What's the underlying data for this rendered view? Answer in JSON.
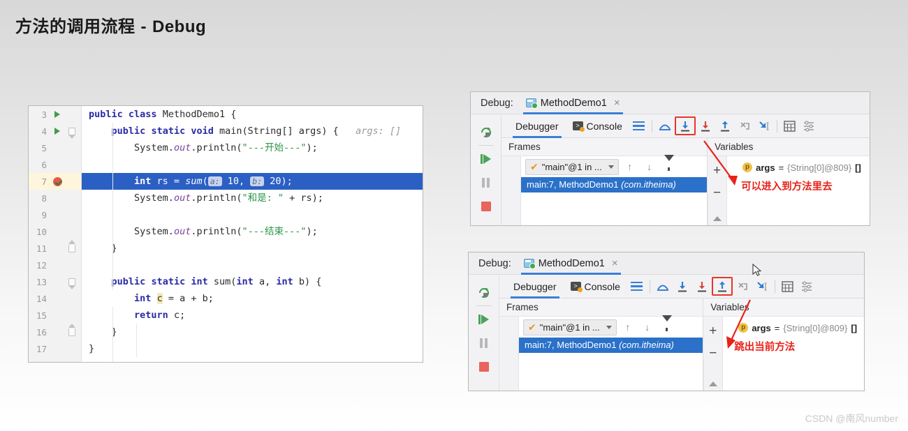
{
  "slide": {
    "title_cn": "方法的调用流程",
    "title_dash": "-",
    "title_en": "Debug"
  },
  "watermark": "CSDN @南风number",
  "editor": {
    "lines": [
      {
        "num": "3",
        "gutter_icon": "run-triangle-icon",
        "fold": "",
        "breakpoint": false
      },
      {
        "num": "4",
        "gutter_icon": "run-triangle-icon",
        "fold": "fold-down",
        "breakpoint": false
      },
      {
        "num": "5",
        "gutter_icon": "",
        "fold": "",
        "breakpoint": false
      },
      {
        "num": "6",
        "gutter_icon": "",
        "fold": "",
        "breakpoint": false
      },
      {
        "num": "7",
        "gutter_icon": "breakpoint-verified-icon",
        "fold": "",
        "breakpoint": true
      },
      {
        "num": "8",
        "gutter_icon": "",
        "fold": "",
        "breakpoint": false
      },
      {
        "num": "9",
        "gutter_icon": "",
        "fold": "",
        "breakpoint": false
      },
      {
        "num": "10",
        "gutter_icon": "",
        "fold": "",
        "breakpoint": false
      },
      {
        "num": "11",
        "gutter_icon": "",
        "fold": "fold-up",
        "breakpoint": false
      },
      {
        "num": "12",
        "gutter_icon": "",
        "fold": "",
        "breakpoint": false
      },
      {
        "num": "13",
        "gutter_icon": "",
        "fold": "fold-down",
        "breakpoint": false
      },
      {
        "num": "14",
        "gutter_icon": "",
        "fold": "",
        "breakpoint": false
      },
      {
        "num": "15",
        "gutter_icon": "",
        "fold": "",
        "breakpoint": false
      },
      {
        "num": "16",
        "gutter_icon": "",
        "fold": "fold-up",
        "breakpoint": false
      },
      {
        "num": "17",
        "gutter_icon": "",
        "fold": "",
        "breakpoint": false
      }
    ],
    "code": {
      "l3_kw1": "public",
      "l3_kw2": "class",
      "l3_name": "MethodDemo1",
      "l3_brace": "{",
      "l4_kw1": "public",
      "l4_kw2": "static",
      "l4_kw3": "void",
      "l4_name": "main",
      "l4_sig": "(String[] args) {",
      "l4_hint": "args: []",
      "l5_sys": "System.",
      "l5_out": "out",
      "l5_print": ".println(",
      "l5_str": "\"---开始---\"",
      "l5_end": ");",
      "l7_kw": "int",
      "l7_var": " rs = ",
      "l7_mth": "sum",
      "l7_p1name": "a:",
      "l7_p1val": "10",
      "l7_comma": ", ",
      "l7_p2name": "b:",
      "l7_p2val": "20",
      "l7_end": ");",
      "l8_sys": "System.",
      "l8_out": "out",
      "l8_print": ".println(",
      "l8_str": "\"和是: \"",
      "l8_plus": " + rs);",
      "l10_sys": "System.",
      "l10_out": "out",
      "l10_print": ".println(",
      "l10_str": "\"---结束---\"",
      "l10_end": ");",
      "l11_brace": "}",
      "l13_kw1": "public",
      "l13_kw2": "static",
      "l13_kw3": "int",
      "l13_name": "sum",
      "l13_sig_open": "(",
      "l13_kw4": "int",
      "l13_a": " a, ",
      "l13_kw5": "int",
      "l13_b": " b) {",
      "l14_kw": "int",
      "l14_c": "c",
      "l14_rest": " = a + b;",
      "l15_kw": "return",
      "l15_c": " c;",
      "l16_brace": "}",
      "l17_brace": "}"
    }
  },
  "debug_panels": [
    {
      "title_label": "Debug:",
      "tab_name": "MethodDemo1",
      "close_label": "×",
      "tabs": {
        "debugger": "Debugger",
        "console": "Console"
      },
      "frames_header": "Frames",
      "variables_header": "Variables",
      "thread_name": "\"main\"@1 in ...",
      "frame_entry_main": "main:7, MethodDemo1",
      "frame_entry_pkg": "(com.itheima)",
      "var_icon_letter": "p",
      "var_name": "args",
      "var_eq": "=",
      "var_value": "{String[0]@809}",
      "var_array": "[]",
      "annotation": "可以进入到方法里去",
      "highlighted_tool": "step-into",
      "add_btn": "+",
      "remove_btn": "−",
      "toolbar_icons": [
        "step-into-icon",
        "force-step-into-icon",
        "step-out-icon",
        "drop-frame-icon",
        "run-to-cursor-icon",
        "evaluate-expression-icon",
        "settings-icon"
      ],
      "sidebar_icons": [
        "rerun-icon",
        "resume-program-icon",
        "pause-program-icon",
        "stop-icon"
      ]
    },
    {
      "title_label": "Debug:",
      "tab_name": "MethodDemo1",
      "close_label": "×",
      "tabs": {
        "debugger": "Debugger",
        "console": "Console"
      },
      "frames_header": "Frames",
      "variables_header": "Variables",
      "thread_name": "\"main\"@1 in ...",
      "frame_entry_main": "main:7, MethodDemo1",
      "frame_entry_pkg": "(com.itheima)",
      "var_icon_letter": "p",
      "var_name": "args",
      "var_eq": "=",
      "var_value": "{String[0]@809}",
      "var_array": "[]",
      "annotation": "跳出当前方法",
      "highlighted_tool": "step-out",
      "add_btn": "+",
      "remove_btn": "−",
      "toolbar_icons": [
        "step-into-icon",
        "force-step-into-icon",
        "step-out-icon",
        "drop-frame-icon",
        "run-to-cursor-icon",
        "evaluate-expression-icon",
        "settings-icon"
      ],
      "sidebar_icons": [
        "rerun-icon",
        "resume-program-icon",
        "pause-program-icon",
        "stop-icon"
      ]
    }
  ],
  "colors": {
    "accent_blue": "#3a7fd5",
    "selection_blue": "#2b5fc4",
    "annotation_red": "#e8231a",
    "highlight_box_red": "#e8352a",
    "string_green": "#2a9546",
    "keyword_blue": "#2a2aa5"
  }
}
